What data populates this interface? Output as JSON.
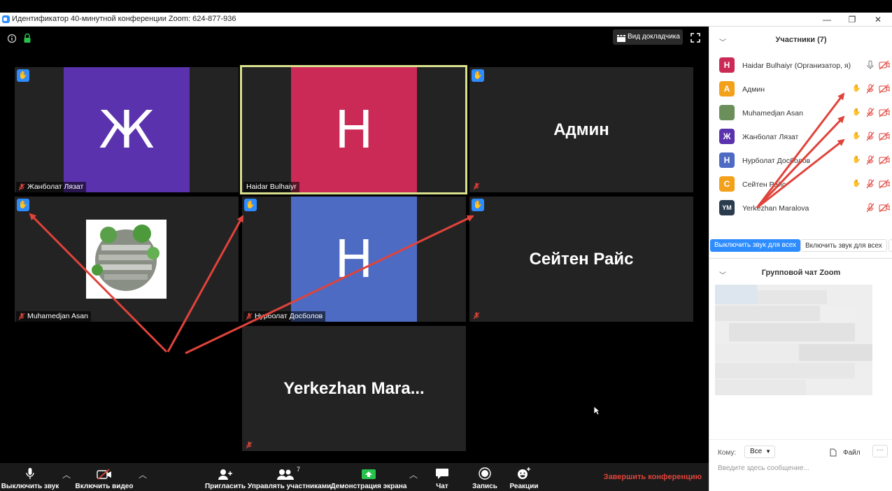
{
  "window": {
    "title": "Идентификатор 40-минутной конференции Zoom: 624-877-936",
    "minimize": "—",
    "restore": "❐",
    "close": "✕"
  },
  "top": {
    "speaker_view": "Вид докладчика"
  },
  "tiles": [
    {
      "name": "Жанболат Лязат",
      "letter": "Ж",
      "color": "#5b32ad",
      "hand": true
    },
    {
      "name": "Haidar Bulhaiyr",
      "letter": "H",
      "color": "#cb2a56",
      "hand": false,
      "active": true
    },
    {
      "name": "Админ",
      "hand": true
    },
    {
      "name": "Muhamedjan Asan",
      "hand": true
    },
    {
      "name": "Нурболат Досболов",
      "letter": "H",
      "color": "#4e6bc4",
      "hand": true
    },
    {
      "name": "Сейтен Райс",
      "hand": true
    },
    {
      "name": "Yerkezhan  Mara..."
    }
  ],
  "toolbar": {
    "mute": "Выключить звук",
    "video": "Включить видео",
    "invite": "Пригласить",
    "participants": "Управлять участниками",
    "participants_count": "7",
    "share": "Демонстрация экрана",
    "chat": "Чат",
    "record": "Запись",
    "reactions": "Реакции",
    "end": "Завершить конференцию"
  },
  "panel": {
    "participants_title": "Участники (7)",
    "participants": [
      {
        "name": "Haidar Bulhaiyr (Организатор, я)",
        "initial": "H",
        "color": "#cb2a56",
        "hand": false
      },
      {
        "name": "Админ",
        "initial": "А",
        "color": "#f3a11b",
        "hand": true
      },
      {
        "name": "Muhamedjan Asan",
        "initial": "",
        "color": "#6b8f5a",
        "hand": true
      },
      {
        "name": "Жанболат Лязат",
        "initial": "Ж",
        "color": "#5b32ad",
        "hand": true
      },
      {
        "name": "Нурболат Досболов",
        "initial": "H",
        "color": "#4e6bc4",
        "hand": true
      },
      {
        "name": "Сейтен Райс",
        "initial": "С",
        "color": "#f3a11b",
        "hand": true
      },
      {
        "name": "Yerkezhan Maralova",
        "initial": "YM",
        "color": "#2b3b4e",
        "hand": false
      }
    ],
    "mute_all": "Выключить звук для всех",
    "unmute_all": "Включить звук для всех",
    "chat_title": "Групповой чат Zoom",
    "to_label": "Кому:",
    "to_value": "Все",
    "file": "Файл",
    "more": "···",
    "message_placeholder": "Введите здесь сообщение..."
  },
  "colors": {
    "accent": "#2d8cff",
    "annotation_arrow": "#e0433a",
    "active_border": "#d9e08c"
  }
}
